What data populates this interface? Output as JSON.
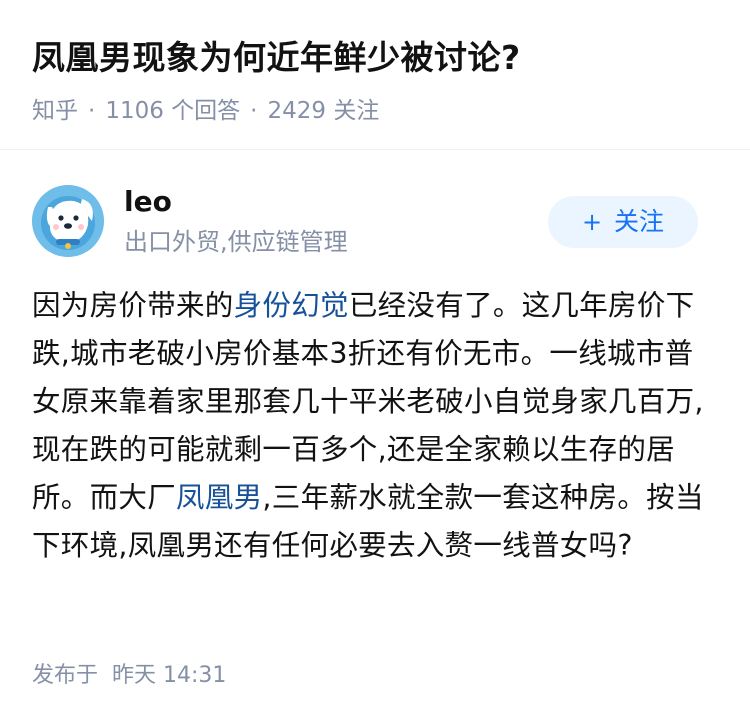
{
  "question": {
    "title": "凤凰男现象为何近年鲜少被讨论?",
    "source": "知乎",
    "answer_count": "1106 个回答",
    "follower_count": "2429 关注",
    "separator": "·"
  },
  "author": {
    "name": "leo",
    "headline": "出口外贸,供应链管理",
    "avatar_icon": "cartoon-dog-avatar"
  },
  "follow_button": {
    "plus": "+",
    "label": "关注"
  },
  "answer": {
    "text_1": "因为房价带来的",
    "link_1": "身份幻觉",
    "text_2": "已经没有了。这几年房价下跌,城市老破小房价基本3折还有价无市。一线城市普女原来靠着家里那套几十平米老破小自觉身家几百万,现在跌的可能就剩一百多个,还是全家赖以生存的居所。而大厂",
    "link_2": "凤凰男",
    "text_3": ",三年薪水就全款一套这种房。按当下环境,凤凰男还有任何必要去入赘一线普女吗?"
  },
  "publish": {
    "label": "发布于",
    "time": "昨天 14:31"
  },
  "colors": {
    "link": "#175199",
    "accent": "#1772f6",
    "meta": "#8590a6",
    "follow_bg": "#ebf5ff"
  }
}
